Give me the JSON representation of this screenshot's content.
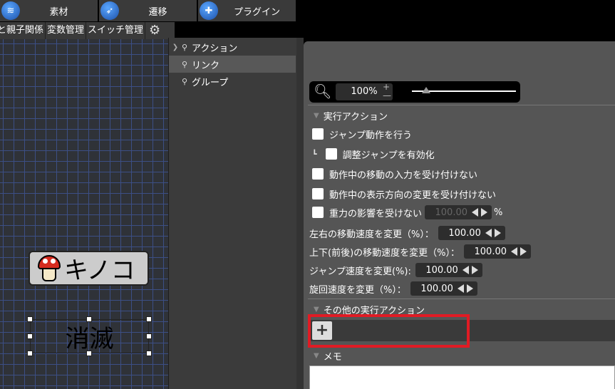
{
  "tabs": [
    {
      "label": "素材",
      "icon": "layers-icon"
    },
    {
      "label": "遷移",
      "icon": "rocket-icon"
    },
    {
      "label": "プラグイン",
      "icon": "puzzle-icon"
    }
  ],
  "subbar": {
    "items": [
      "と親子関係",
      "変数管理",
      "スイッチ管理"
    ],
    "settings_icon": "gear-icon"
  },
  "canvas": {
    "nodes": [
      {
        "label": "キノコ",
        "icon": "mushroom-icon"
      },
      {
        "label": "消滅"
      }
    ]
  },
  "tree": {
    "items": [
      {
        "label": "アクション",
        "selected": false,
        "has_arrow": true
      },
      {
        "label": "リンク",
        "selected": true,
        "has_arrow": false
      },
      {
        "label": "グループ",
        "selected": false,
        "has_arrow": false
      }
    ]
  },
  "zoom": {
    "value": "100%",
    "plus": "+",
    "minus": "—",
    "slider_level": 0.14
  },
  "sections": {
    "exec_action": "実行アクション",
    "other_exec_action": "その他の実行アクション",
    "memo": "メモ"
  },
  "checkboxes": [
    {
      "label": "ジャンプ動作を行う",
      "checked": false
    },
    {
      "label": "調整ジャンプを有効化",
      "checked": false,
      "indent": true,
      "prefix": "┗"
    },
    {
      "label": "動作中の移動の入力を受け付けない",
      "checked": false
    },
    {
      "label": "動作中の表示方向の変更を受け付けない",
      "checked": false
    },
    {
      "label": "重力の影響を受けない",
      "checked": false,
      "value": "100.00",
      "unit": "%"
    }
  ],
  "number_fields": [
    {
      "label": "左右の移動速度を変更（%）：",
      "value": "100.00"
    },
    {
      "label": "上下(前後)の移動速度を変更（%）：",
      "value": "100.00"
    },
    {
      "label": "ジャンプ速度を変更(%):",
      "value": "100.00"
    },
    {
      "label": "旋回速度を変更（%）：",
      "value": "100.00"
    }
  ],
  "add_button": {
    "label": "+"
  },
  "colors": {
    "highlight": "#e01b24",
    "tab_bg": "#3a3a3a",
    "canvas_bg": "#2f3238",
    "grid": "#3c4f86",
    "panel_bg": "#555555"
  }
}
